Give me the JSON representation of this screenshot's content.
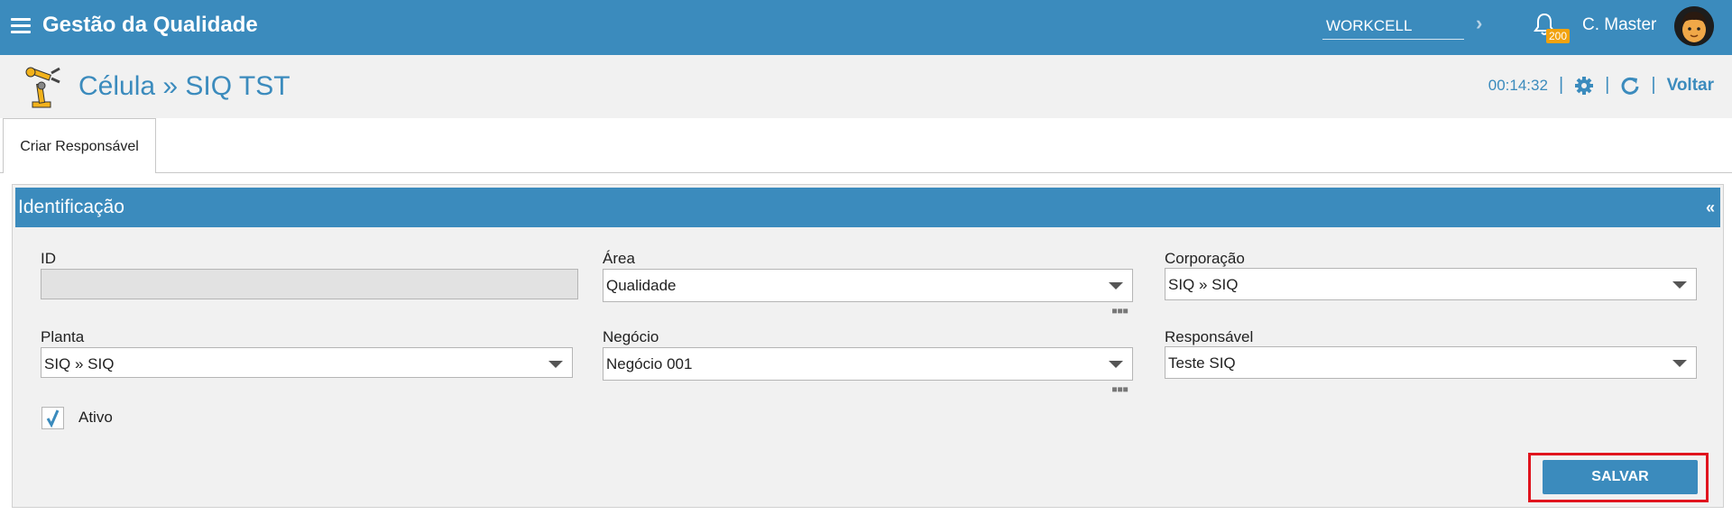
{
  "app": {
    "title": "Gestão da Qualidade",
    "workcell": "WORKCELL",
    "notifications_count": "200",
    "user_name": "C. Master"
  },
  "page": {
    "title": "Célula » SIQ TST",
    "timer": "00:14:32",
    "back_label": "Voltar"
  },
  "tabs": [
    {
      "label": "Criar Responsável",
      "active": true
    }
  ],
  "panel": {
    "title": "Identificação",
    "collapse_glyph": "«"
  },
  "form": {
    "id": {
      "label": "ID",
      "value": ""
    },
    "area": {
      "label": "Área",
      "value": "Qualidade"
    },
    "corporacao": {
      "label": "Corporação",
      "value": "SIQ » SIQ"
    },
    "planta": {
      "label": "Planta",
      "value": "SIQ » SIQ"
    },
    "negocio": {
      "label": "Negócio",
      "value": "Negócio 001"
    },
    "responsavel": {
      "label": "Responsável",
      "value": "Teste SIQ"
    },
    "ativo": {
      "label": "Ativo",
      "checked": true
    }
  },
  "actions": {
    "save_label": "SALVAR"
  },
  "colors": {
    "primary": "#3b8bbd",
    "badge": "#f2a20d",
    "highlight": "#e0141e"
  }
}
